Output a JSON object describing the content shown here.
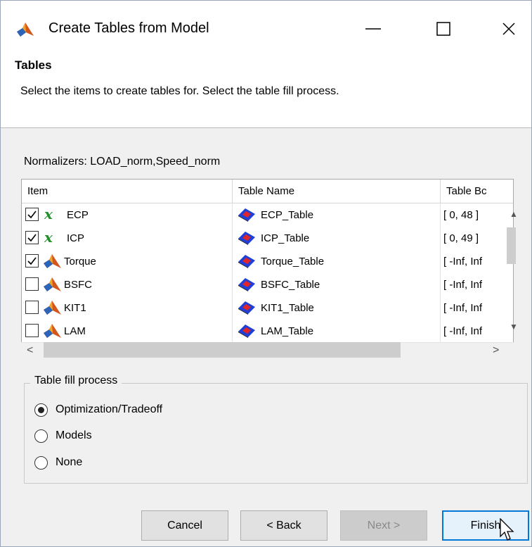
{
  "window": {
    "title": "Create Tables from Model"
  },
  "header": {
    "title": "Tables",
    "description": "Select the items to create tables for. Select the table fill process."
  },
  "normalizers": "Normalizers: LOAD_norm,Speed_norm",
  "table": {
    "columns": [
      "Item",
      "Table Name",
      "Table Bc"
    ],
    "rows": [
      {
        "checked": true,
        "icon": "variable-x-icon",
        "item": "ECP",
        "table_name": "ECP_Table",
        "bounds": "[ 0, 48 ]"
      },
      {
        "checked": true,
        "icon": "variable-x-icon",
        "item": "ICP",
        "table_name": "ICP_Table",
        "bounds": "[ 0, 49 ]"
      },
      {
        "checked": true,
        "icon": "matlab-model-icon",
        "item": "Torque",
        "table_name": "Torque_Table",
        "bounds": "[ -Inf, Inf"
      },
      {
        "checked": false,
        "icon": "matlab-model-icon",
        "item": "BSFC",
        "table_name": "BSFC_Table",
        "bounds": "[ -Inf, Inf"
      },
      {
        "checked": false,
        "icon": "matlab-model-icon",
        "item": "KIT1",
        "table_name": "KIT1_Table",
        "bounds": "[ -Inf, Inf"
      },
      {
        "checked": false,
        "icon": "matlab-model-icon",
        "item": "LAM",
        "table_name": "LAM_Table",
        "bounds": "[ -Inf, Inf"
      }
    ]
  },
  "fill_process": {
    "label": "Table fill process",
    "options": [
      "Optimization/Tradeoff",
      "Models",
      "None"
    ],
    "selected": "Optimization/Tradeoff"
  },
  "buttons": {
    "cancel": "Cancel",
    "back": "< Back",
    "next": "Next >",
    "finish": "Finish"
  },
  "colors": {
    "variable_icon": "#21902a",
    "model_icon": "#d4561d",
    "table_icon": "#1f3fd6",
    "focus_border": "#0078d7"
  }
}
